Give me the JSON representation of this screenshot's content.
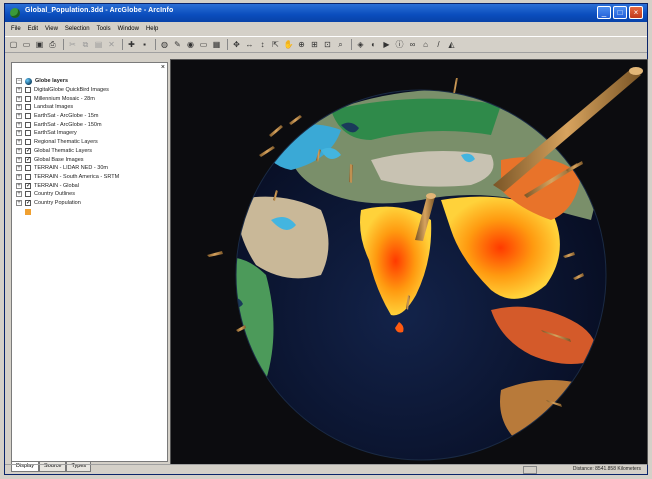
{
  "window": {
    "title": "Global_Population.3dd - ArcGlobe - ArcInfo",
    "controls": [
      "_",
      "□",
      "×"
    ]
  },
  "menu": [
    "File",
    "Edit",
    "View",
    "Selection",
    "Tools",
    "Window",
    "Help"
  ],
  "toolbar": {
    "icons": [
      "new-icon",
      "open-icon",
      "save-icon",
      "print-icon",
      "cut-icon",
      "copy-icon",
      "paste-icon",
      "delete-icon",
      "add-data-icon",
      "arcmap-icon",
      "globe-icon",
      "editor-icon",
      "catalog-icon",
      "toolbox-icon",
      "layer-icon",
      "navigate-icon",
      "fly-icon",
      "zoom-in-icon",
      "zoom-out-icon",
      "pan-icon",
      "full-extent-icon",
      "select-icon",
      "identify-icon",
      "find-icon",
      "measure-icon",
      "hyperlink-icon",
      "animation-icon"
    ]
  },
  "toc": {
    "root": "Globe layers",
    "layers": [
      {
        "label": "DigitalGlobe QuickBird Images",
        "checked": false
      },
      {
        "label": "Millennium Mosaic - 28m",
        "checked": false
      },
      {
        "label": "Landsat Images",
        "checked": false
      },
      {
        "label": "EarthSat - ArcGlobe - 15m",
        "checked": false
      },
      {
        "label": "EarthSat - ArcGlobe - 150m",
        "checked": false
      },
      {
        "label": "EarthSat Imagery",
        "checked": false
      },
      {
        "label": "Regional Thematic Layers",
        "checked": false
      },
      {
        "label": "Global Thematic Layers",
        "checked": true
      },
      {
        "label": "Global Base Images",
        "checked": true
      },
      {
        "label": "TERRAIN - LIDAR NED - 30m",
        "checked": false
      },
      {
        "label": "TERRAIN - South America - SRTM",
        "checked": false
      },
      {
        "label": "TERRAIN - Global",
        "checked": true
      },
      {
        "label": "Country Outlines",
        "checked": false
      },
      {
        "label": "Country Population",
        "checked": true
      }
    ],
    "tabs": [
      "Display",
      "Source",
      "Types"
    ]
  },
  "status": {
    "text": "Distance: 8541.858 Kilometers"
  },
  "colors": {
    "titlebar": "#0a4dbd",
    "ocean": "#0e1a3a",
    "background": "#0c0c0f",
    "population_bar": "#b98a4c"
  }
}
